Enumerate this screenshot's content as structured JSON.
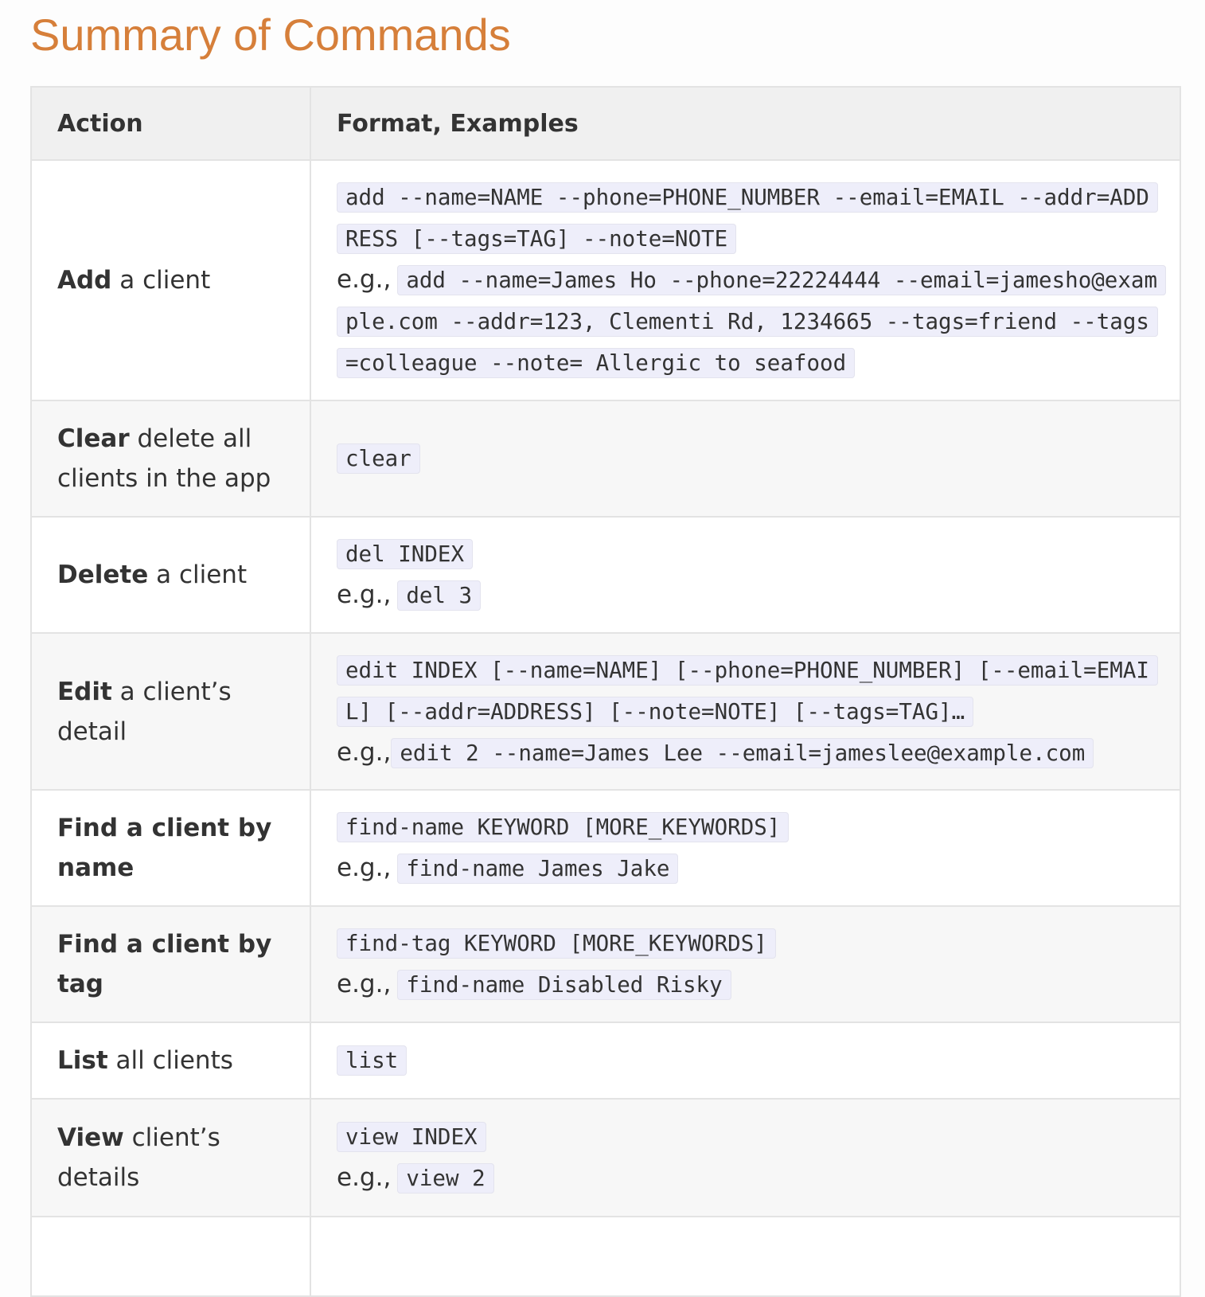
{
  "title": "Summary of Commands",
  "table": {
    "headers": [
      "Action",
      "Format, Examples"
    ],
    "rows": [
      {
        "action_bold": "Add",
        "action_rest": " a client",
        "format": "add --name=NAME --phone=PHONE_NUMBER --email=EMAIL --addr=ADDRESS [--tags=TAG] --note=NOTE",
        "example_prefix": "e.g.,",
        "example": "add --name=James Ho --phone=22224444 --email=jamesho@example.com --addr=123, Clementi Rd, 1234665 --tags=friend --tags=colleague --note= Allergic to seafood"
      },
      {
        "action_bold": "Clear",
        "action_rest": " delete all clients in the app",
        "format": "clear",
        "example_prefix": "",
        "example": ""
      },
      {
        "action_bold": "Delete",
        "action_rest": " a client",
        "format": "del INDEX",
        "example_prefix": "e.g.,",
        "example": "del 3"
      },
      {
        "action_bold": "Edit",
        "action_rest": " a client’s detail",
        "format": "edit INDEX [--name=NAME] [--phone=PHONE_NUMBER] [--email=EMAIL] [--addr=ADDRESS] [--note=NOTE] [--tags=TAG]…",
        "example_prefix": "e.g.,",
        "example": "edit 2 --name=James Lee --email=jameslee@example.com"
      },
      {
        "action_bold": "Find a client by name",
        "action_rest": "",
        "format": "find-name KEYWORD [MORE_KEYWORDS]",
        "example_prefix": "e.g.,",
        "example": "find-name James Jake"
      },
      {
        "action_bold": "Find a client by tag",
        "action_rest": "",
        "format": "find-tag KEYWORD [MORE_KEYWORDS]",
        "example_prefix": "e.g.,",
        "example": "find-name Disabled Risky"
      },
      {
        "action_bold": "List",
        "action_rest": " all clients",
        "format": "list",
        "example_prefix": "",
        "example": ""
      },
      {
        "action_bold": "View",
        "action_rest": " client’s details",
        "format": "view INDEX",
        "example_prefix": "e.g.,",
        "example": "view 2"
      },
      {
        "action_bold": "",
        "action_rest": "",
        "format": "",
        "example_prefix": "",
        "example": ""
      }
    ]
  },
  "colors": {
    "title": "#d67f3a",
    "code_background": "#eeeefa",
    "header_background": "#f0f0f0",
    "striped_row": "#f7f7f7"
  }
}
